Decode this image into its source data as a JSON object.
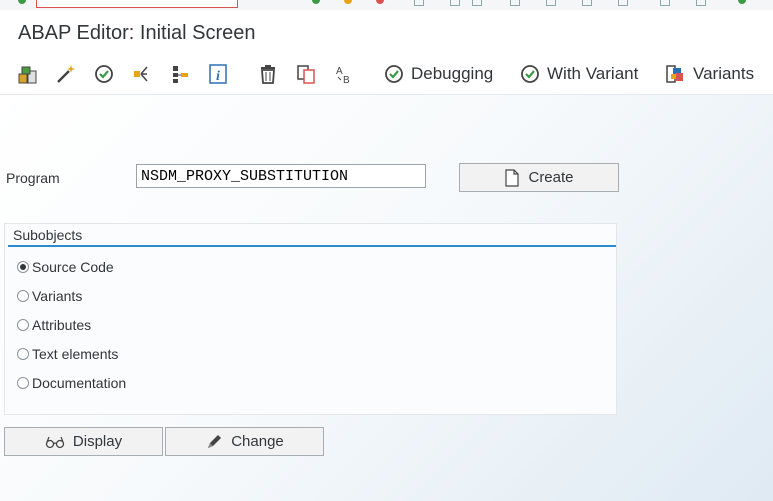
{
  "window": {
    "title": "ABAP Editor: Initial Screen"
  },
  "toolbar": {
    "icons": [
      "object-list-icon",
      "magic-wand-icon",
      "execute-icon",
      "where-used-icon",
      "hierarchy-icon",
      "info-icon",
      "delete-icon",
      "copy-icon",
      "rename-icon"
    ],
    "debugging_label": "Debugging",
    "with_variant_label": "With Variant",
    "variants_label": "Variants"
  },
  "program": {
    "label": "Program",
    "value": "NSDM_PROXY_SUBSTITUTION"
  },
  "create_label": "Create",
  "subobjects": {
    "title": "Subobjects",
    "options": [
      {
        "label": "Source Code",
        "selected": true
      },
      {
        "label": "Variants",
        "selected": false
      },
      {
        "label": "Attributes",
        "selected": false
      },
      {
        "label": "Text elements",
        "selected": false
      },
      {
        "label": "Documentation",
        "selected": false
      }
    ]
  },
  "actions": {
    "display_label": "Display",
    "change_label": "Change"
  },
  "colors": {
    "accent": "#2d8ad1",
    "background": "#ffffff"
  }
}
